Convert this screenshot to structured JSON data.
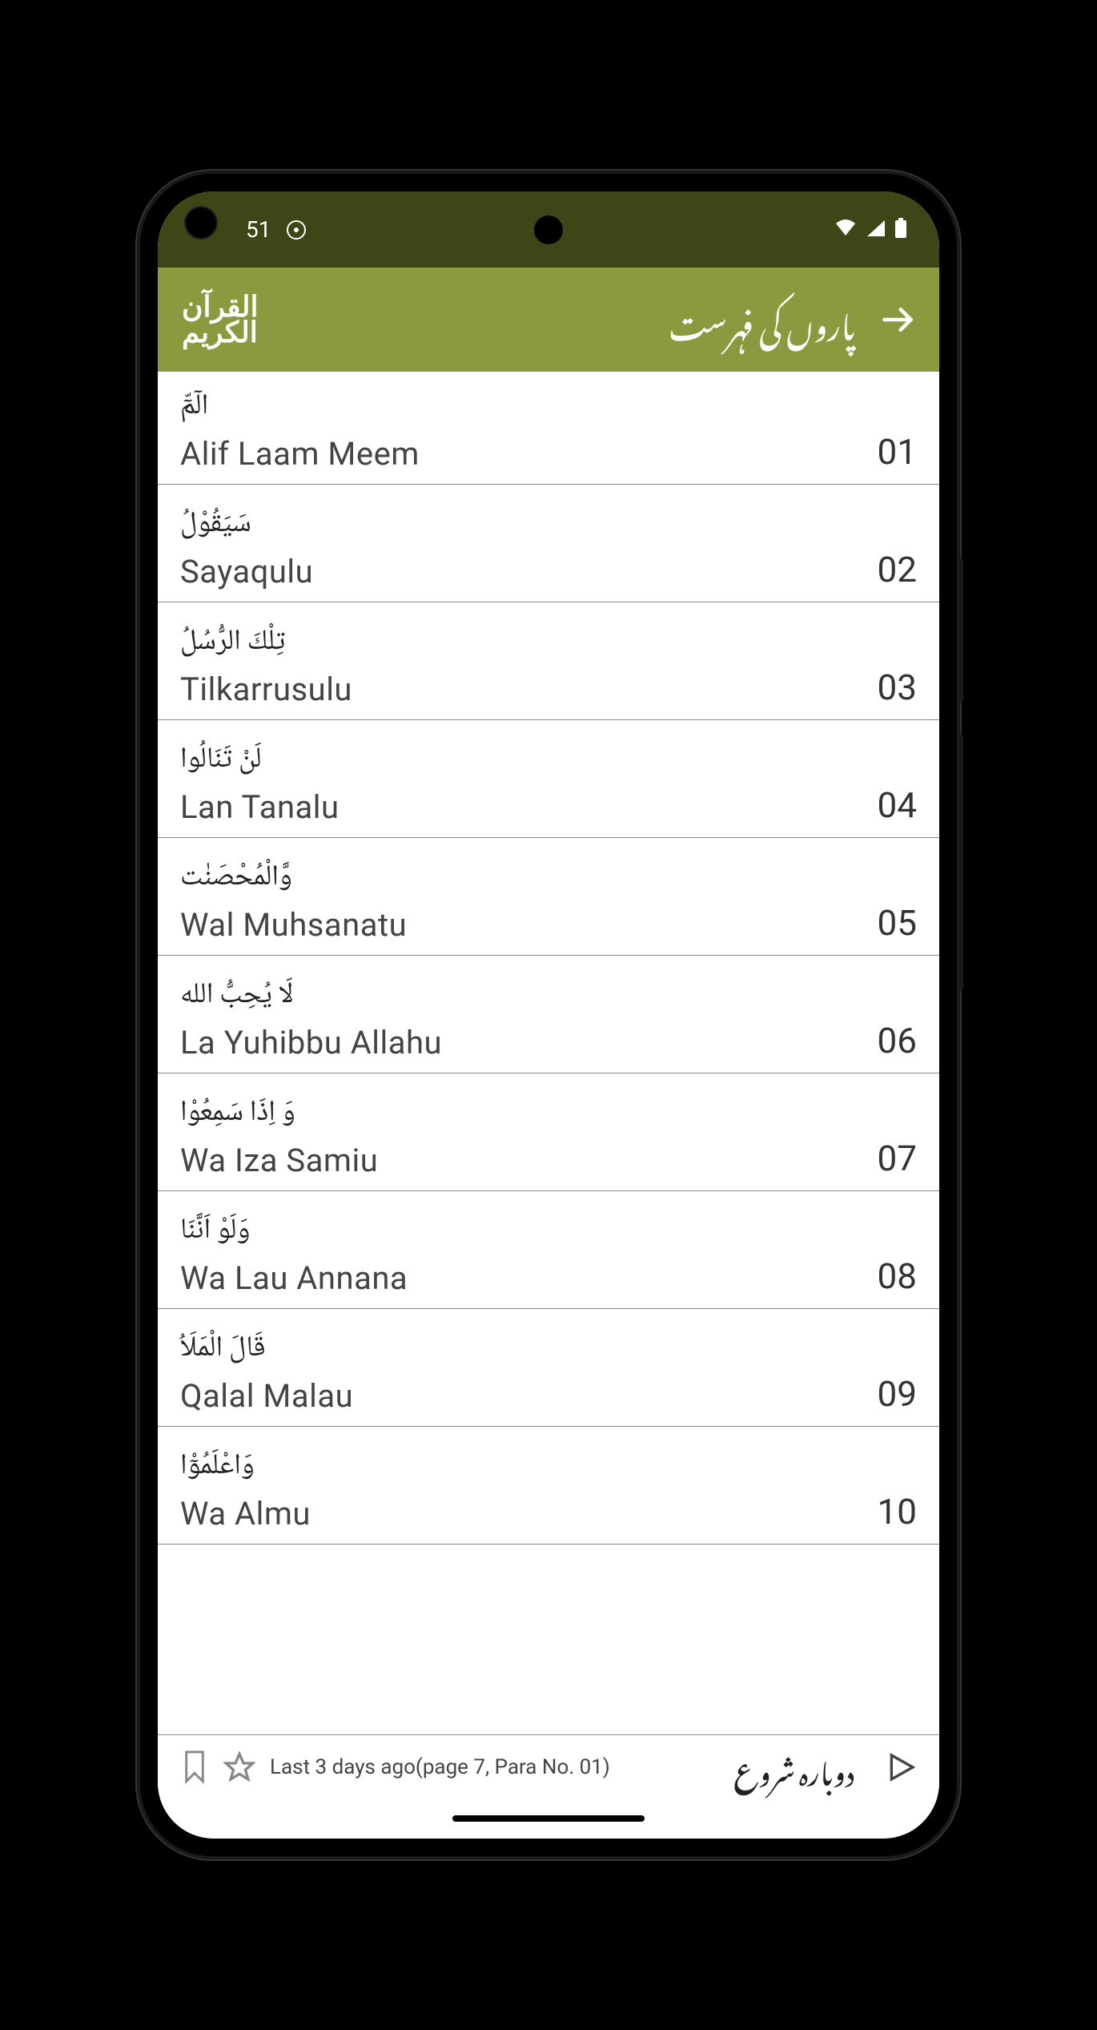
{
  "status": {
    "time": "51",
    "wifi": true,
    "signal": true,
    "battery": true
  },
  "appbar": {
    "logo_line1": "القرآن",
    "logo_line2": "الكريم",
    "title": "پاروں کی فہرست"
  },
  "items": [
    {
      "arabic": "الٓمّٓ",
      "latin": "Alif  Laam  Meem",
      "num": "01"
    },
    {
      "arabic": "سَيَقُوْلُ",
      "latin": "Sayaqulu",
      "num": "02"
    },
    {
      "arabic": "تِلْكَ الرُّسُلُ",
      "latin": "Tilkarrusulu",
      "num": "03"
    },
    {
      "arabic": "لَنْ تَنَالُوا",
      "latin": "Lan Tanalu",
      "num": "04"
    },
    {
      "arabic": "وَّالْمُحْصَنٰت",
      "latin": "Wal Muhsanatu",
      "num": "05"
    },
    {
      "arabic": "لَا يُحِبُّ الله",
      "latin": "La Yuhibbu Allahu",
      "num": "06"
    },
    {
      "arabic": "وَ اِذَا سَمِعُوْا",
      "latin": "Wa Iza Samiu",
      "num": "07"
    },
    {
      "arabic": "وَلَوْ اَنَّنَا",
      "latin": "Wa Lau Annana",
      "num": "08"
    },
    {
      "arabic": "قَالَ الْمَلَاُ",
      "latin": "Qalal Malau",
      "num": "09"
    },
    {
      "arabic": "وَاعْلَمُوْٓا",
      "latin": "Wa Almu",
      "num": "10"
    }
  ],
  "bottom": {
    "last_text": "Last 3 days ago(page 7, Para No. 01)",
    "resume_text": "دوباره شروع"
  }
}
